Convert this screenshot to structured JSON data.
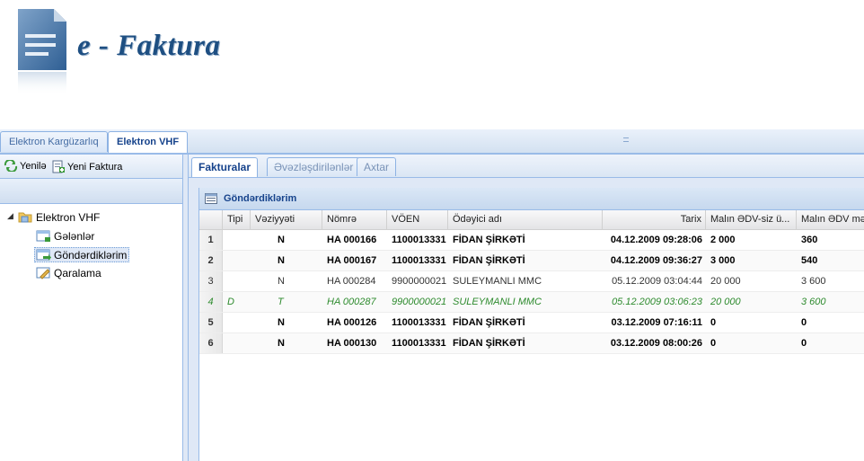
{
  "brand": {
    "title": "e - Faktura"
  },
  "top_tabs": [
    {
      "label": "Elektron Kargüzarlıq",
      "active": false
    },
    {
      "label": "Elektron VHF",
      "active": true
    }
  ],
  "toolbar": {
    "refresh_label": "Yenilə",
    "new_invoice_label": "Yeni Faktura"
  },
  "tree": {
    "root": "Elektron VHF",
    "items": [
      {
        "label": "Gələnlər",
        "selected": false
      },
      {
        "label": "Göndərdiklərim",
        "selected": true
      },
      {
        "label": "Qaralama",
        "selected": false
      }
    ]
  },
  "inner_tabs": [
    {
      "label": "Fakturalar",
      "active": true
    },
    {
      "label": "Əvəzləşdirilənlər",
      "active": false
    },
    {
      "label": "Axtar",
      "active": false
    }
  ],
  "grid": {
    "title": "Göndərdiklərim",
    "columns": [
      "",
      "Tipi",
      "Vəziyyəti",
      "Nömrə",
      "VÖEN",
      "Ödəyici adı",
      "Tarix",
      "Malın ƏDV-siz ü...",
      "Malın ƏDV mə"
    ],
    "rows": [
      {
        "num": "1",
        "tipi": "",
        "status": "N",
        "nomre": "HA 000166",
        "voen": "1100013331",
        "name": "FİDAN ŞİRKƏTİ",
        "date": "04.12.2009 09:28:06",
        "amount": "2 000",
        "vat": "360",
        "style": "bold"
      },
      {
        "num": "2",
        "tipi": "",
        "status": "N",
        "nomre": "HA 000167",
        "voen": "1100013331",
        "name": "FİDAN ŞİRKƏTİ",
        "date": "04.12.2009 09:36:27",
        "amount": "3 000",
        "vat": "540",
        "style": "bold"
      },
      {
        "num": "3",
        "tipi": "",
        "status": "N",
        "nomre": "HA 000284",
        "voen": "9900000021",
        "name": "SULEYMANLI MMC",
        "date": "05.12.2009 03:04:44",
        "amount": "20 000",
        "vat": "3 600",
        "style": "plain"
      },
      {
        "num": "4",
        "tipi": "D",
        "status": "T",
        "nomre": "HA 000287",
        "voen": "9900000021",
        "name": "SULEYMANLI MMC",
        "date": "05.12.2009 03:06:23",
        "amount": "20 000",
        "vat": "3 600",
        "style": "green"
      },
      {
        "num": "5",
        "tipi": "",
        "status": "N",
        "nomre": "HA 000126",
        "voen": "1100013331",
        "name": "FİDAN ŞİRKƏTİ",
        "date": "03.12.2009 07:16:11",
        "amount": "0",
        "vat": "0",
        "style": "bold"
      },
      {
        "num": "6",
        "tipi": "",
        "status": "N",
        "nomre": "HA 000130",
        "voen": "1100013331",
        "name": "FİDAN ŞİRKƏTİ",
        "date": "03.12.2009 08:00:26",
        "amount": "0",
        "vat": "0",
        "style": "bold"
      }
    ]
  },
  "colors": {
    "accent": "#15428b",
    "border": "#99bbe8",
    "panel": "#dfe8f6",
    "green_row": "#2e8b2e"
  },
  "icons": [
    "document-logo-icon",
    "refresh-icon",
    "new-invoice-icon",
    "folder-icon",
    "inbox-icon",
    "sent-icon",
    "draft-icon",
    "grid-icon",
    "expand-arrow-icon"
  ]
}
